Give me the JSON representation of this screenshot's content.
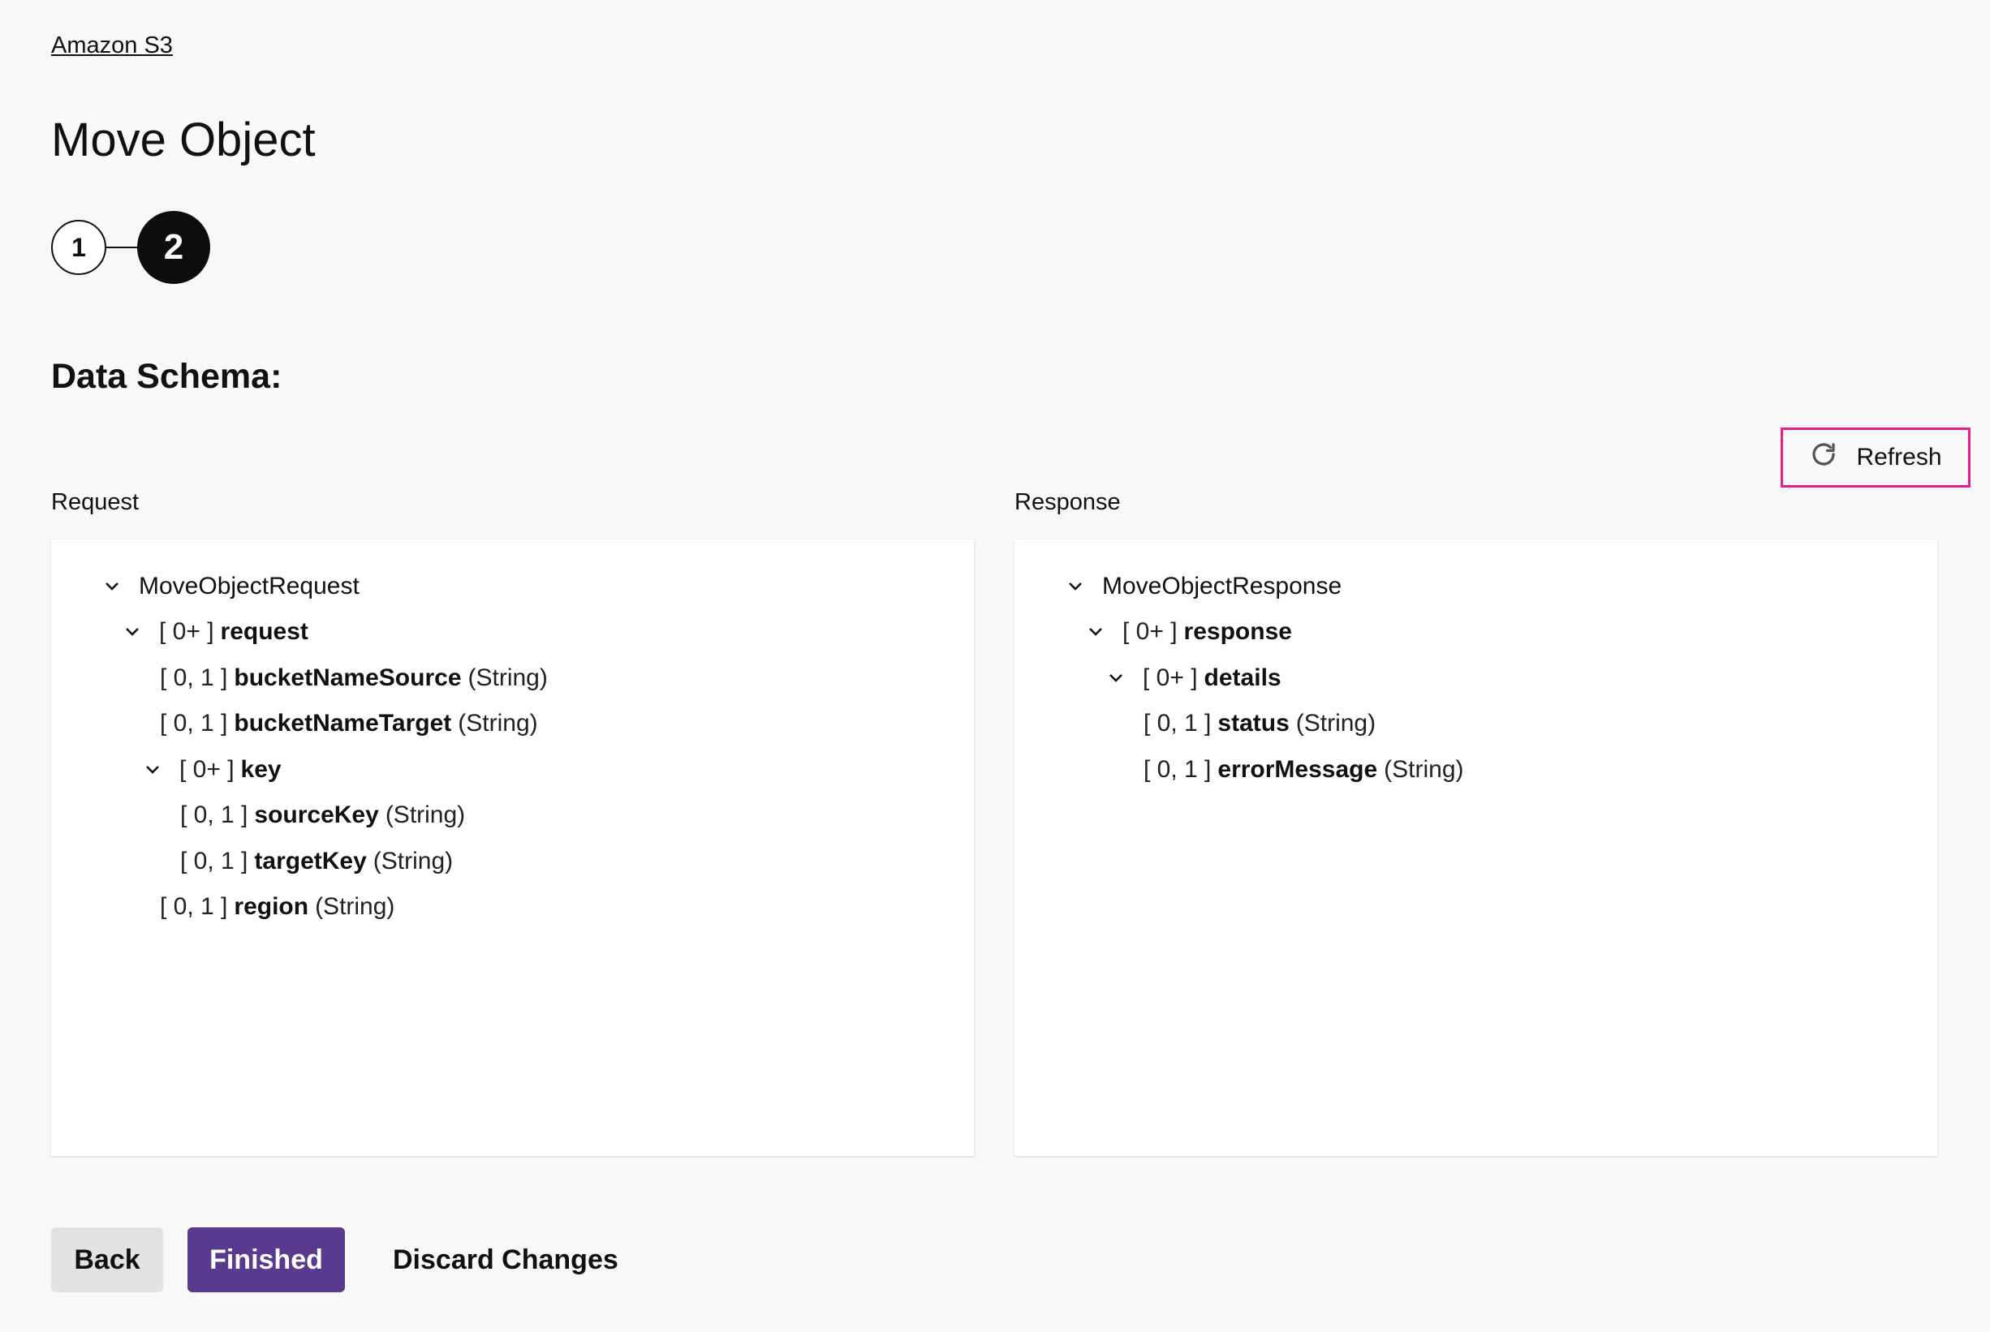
{
  "breadcrumb": {
    "label": "Amazon S3"
  },
  "page": {
    "title": "Move Object"
  },
  "stepper": {
    "steps": [
      {
        "label": "1",
        "state": "completed"
      },
      {
        "label": "2",
        "state": "active"
      }
    ]
  },
  "schema": {
    "title": "Data Schema:",
    "refresh_label": "Refresh",
    "refresh_icon": "refresh-icon"
  },
  "request": {
    "label": "Request",
    "root": "MoveObjectRequest",
    "nodes": [
      {
        "card": "[ 0+ ]",
        "name": "request",
        "type": ""
      },
      {
        "card": "[ 0, 1 ]",
        "name": "bucketNameSource",
        "type": "(String)"
      },
      {
        "card": "[ 0, 1 ]",
        "name": "bucketNameTarget",
        "type": "(String)"
      },
      {
        "card": "[ 0+ ]",
        "name": "key",
        "type": ""
      },
      {
        "card": "[ 0, 1 ]",
        "name": "sourceKey",
        "type": "(String)"
      },
      {
        "card": "[ 0, 1 ]",
        "name": "targetKey",
        "type": "(String)"
      },
      {
        "card": "[ 0, 1 ]",
        "name": "region",
        "type": "(String)"
      }
    ]
  },
  "response": {
    "label": "Response",
    "root": "MoveObjectResponse",
    "nodes": [
      {
        "card": "[ 0+ ]",
        "name": "response",
        "type": ""
      },
      {
        "card": "[ 0+ ]",
        "name": "details",
        "type": ""
      },
      {
        "card": "[ 0, 1 ]",
        "name": "status",
        "type": "(String)"
      },
      {
        "card": "[ 0, 1 ]",
        "name": "errorMessage",
        "type": "(String)"
      }
    ]
  },
  "footer": {
    "back_label": "Back",
    "finished_label": "Finished",
    "discard_label": "Discard Changes"
  },
  "colors": {
    "accent": "#5a3a8e",
    "highlight": "#e91e8c",
    "background": "#f8f8f8"
  }
}
